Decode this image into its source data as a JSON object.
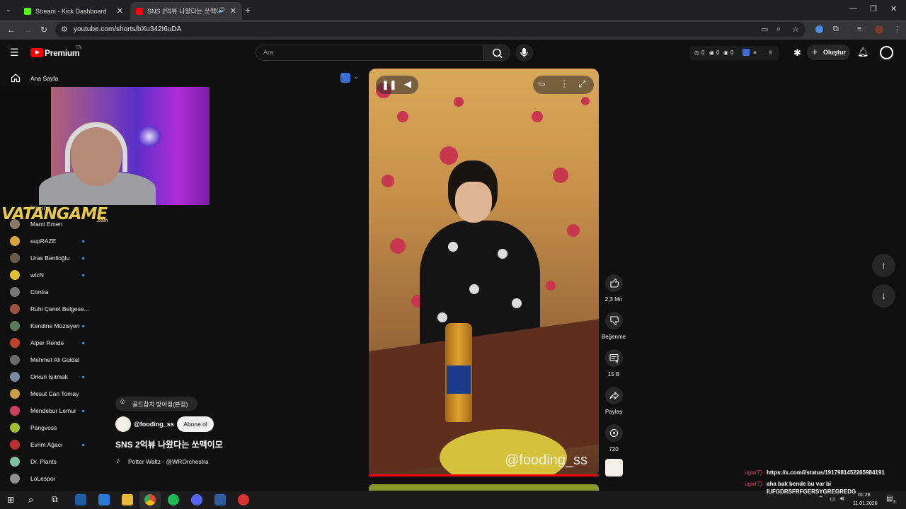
{
  "browser": {
    "tabs": [
      {
        "label": "Stream - Kick Dashboard"
      },
      {
        "label": "SNS 2억뷰 나왔다는 쏘맥이"
      }
    ],
    "url": "youtube.com/shorts/bXu342I6uDA"
  },
  "header": {
    "brand": "Premium",
    "country": "TR",
    "search_placeholder": "Ara",
    "ext_counts": [
      "0",
      "0",
      "0"
    ],
    "create_label": "Oluştur"
  },
  "sidebar": {
    "home": "Ana Sayfa",
    "partial": "Elraenn",
    "items": [
      {
        "label": "Mami Emen",
        "dot": false,
        "color": "#8a7a6a"
      },
      {
        "label": "supRAZE",
        "dot": true,
        "color": "#d9a23a"
      },
      {
        "label": "Uras Benlioğlu",
        "dot": true,
        "color": "#6a5a4a"
      },
      {
        "label": "wtcN",
        "dot": true,
        "color": "#e0c030"
      },
      {
        "label": "Contra",
        "dot": false,
        "color": "#777777"
      },
      {
        "label": "Ruhi Çenet Belgese...",
        "dot": false,
        "color": "#a05040"
      },
      {
        "label": "Kendine Müzisyen",
        "dot": true,
        "color": "#5a7a5a"
      },
      {
        "label": "Alper Rende",
        "dot": true,
        "color": "#c04030"
      },
      {
        "label": "Mehmet Ali Güldal",
        "dot": false,
        "color": "#6a6a6a"
      },
      {
        "label": "Orkun Işıtmak",
        "dot": true,
        "color": "#7a8aa0"
      },
      {
        "label": "Mesut Can Tomay",
        "dot": false,
        "color": "#c8a040"
      },
      {
        "label": "Mendebur Lemur",
        "dot": true,
        "color": "#d04060"
      },
      {
        "label": "Pangvoss",
        "dot": false,
        "color": "#a0c030"
      },
      {
        "label": "Evrim Ağacı",
        "dot": true,
        "color": "#c03030"
      },
      {
        "label": "Dr. Plants",
        "dot": false,
        "color": "#80c0a0"
      },
      {
        "label": "LoLespor",
        "dot": false,
        "color": "#909090"
      }
    ]
  },
  "overlay": {
    "logo": "VATANGAME",
    "logo_suffix": ".com"
  },
  "video": {
    "watermark": "@fooding_ss",
    "progress": 0.99,
    "location": "골드참치 방어점(본점)",
    "channel": "@fooding_ss",
    "subscribe": "Abone ol",
    "title": "SNS 2억뷰 나왔다는 쏘맥이모",
    "music": "Potter Waltz · @WROrchestra"
  },
  "actions": {
    "like": "2,3 Mn",
    "dislike": "Beğenme",
    "comments": "15 B",
    "share": "Paylaş",
    "remix": "720"
  },
  "chat": [
    {
      "user": "ugwr7)",
      "text": "https://x.com/i/status/1917981452265984191"
    },
    {
      "user": "ugwr7)",
      "text": "aha bak bende bu var bi"
    },
    {
      "user": "",
      "text": "IUFGDRSFRFGERSYGREGREDG"
    }
  ],
  "taskbar": {
    "time": "01:28",
    "date": "11.01.2026",
    "notif": "3"
  }
}
